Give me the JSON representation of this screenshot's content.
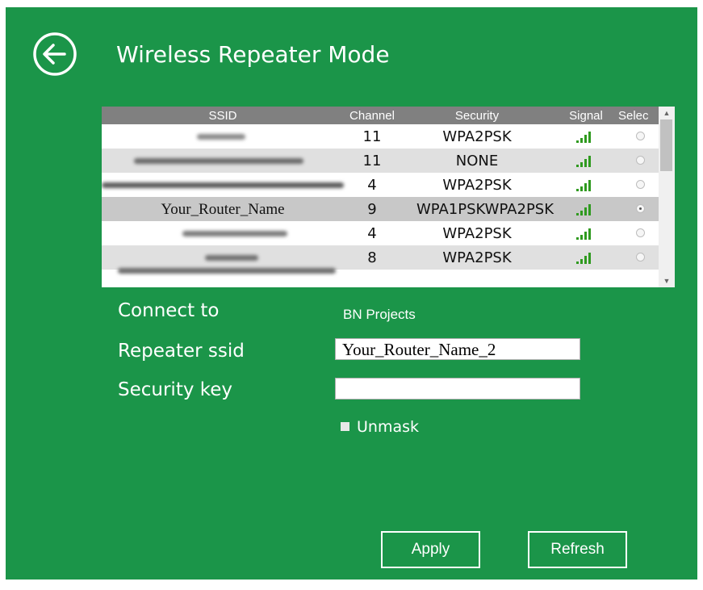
{
  "header": {
    "title": "Wireless Repeater Mode"
  },
  "table": {
    "columns": [
      "SSID",
      "Channel",
      "Security",
      "Signal",
      "Selec"
    ],
    "rows": [
      {
        "ssid": "",
        "channel": "11",
        "security": "WPA2PSK",
        "selected": false
      },
      {
        "ssid": "",
        "channel": "11",
        "security": "NONE",
        "selected": false
      },
      {
        "ssid": "",
        "channel": "4",
        "security": "WPA2PSK",
        "selected": false
      },
      {
        "ssid": "Your_Router_Name",
        "channel": "9",
        "security": "WPA1PSKWPA2PSK",
        "selected": true
      },
      {
        "ssid": "",
        "channel": "4",
        "security": "WPA2PSK",
        "selected": false
      },
      {
        "ssid": "",
        "channel": "8",
        "security": "WPA2PSK",
        "selected": false
      }
    ]
  },
  "form": {
    "connect_to_label": "Connect to",
    "connect_to_value": "BN Projects",
    "repeater_ssid_label": "Repeater ssid",
    "repeater_ssid_value": "Your_Router_Name_2",
    "security_key_label": "Security key",
    "security_key_value": "",
    "unmask_label": "Unmask"
  },
  "buttons": {
    "apply": "Apply",
    "refresh": "Refresh"
  },
  "colors": {
    "background": "#1b9549",
    "header_row": "#808080",
    "row_alt": "#e0e0e0",
    "row_selected": "#c8c8c8",
    "signal": "#2f9a1f"
  }
}
